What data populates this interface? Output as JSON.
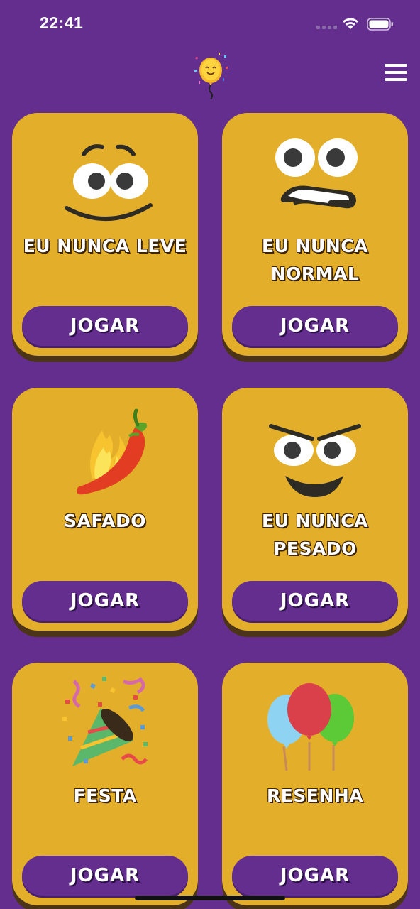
{
  "status_bar": {
    "time": "22:41"
  },
  "header": {
    "logo_icon": "balloon-logo-icon",
    "menu_icon": "hamburger-menu-icon"
  },
  "colors": {
    "background": "#632e8e",
    "card": "#e3af2b",
    "button": "#632e8e"
  },
  "cards": [
    {
      "title": "EU NUNCA LEVE",
      "button_label": "JOGAR",
      "icon": "worried-smile-face-icon"
    },
    {
      "title": "EU NUNCA NORMAL",
      "button_label": "JOGAR",
      "icon": "grimacing-face-icon"
    },
    {
      "title": "SAFADO",
      "button_label": "JOGAR",
      "icon": "hot-pepper-icon"
    },
    {
      "title": "EU NUNCA PESADO",
      "button_label": "JOGAR",
      "icon": "mischievous-face-icon"
    },
    {
      "title": "FESTA",
      "button_label": "JOGAR",
      "icon": "party-popper-icon"
    },
    {
      "title": "RESENHA",
      "button_label": "JOGAR",
      "icon": "balloons-icon"
    }
  ]
}
